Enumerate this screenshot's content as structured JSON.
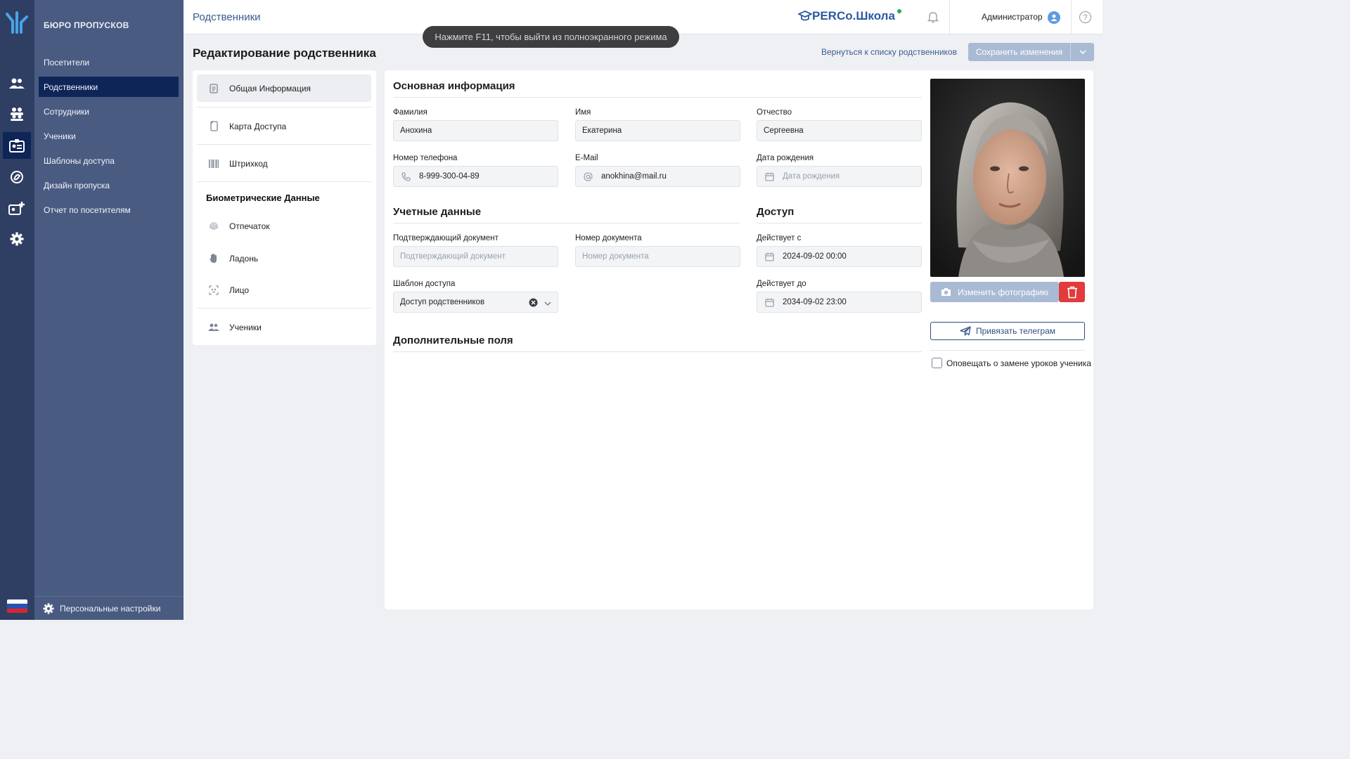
{
  "colors": {
    "rail": "#2f3f63",
    "menu": "#4a5b82",
    "active": "#0e2558",
    "accent": "#2c5aa0",
    "danger": "#e23b3b"
  },
  "menu": {
    "brand": "БЮРО ПРОПУСКОВ",
    "items": [
      {
        "label": "Посетители"
      },
      {
        "label": "Родственники"
      },
      {
        "label": "Сотрудники"
      },
      {
        "label": "Ученики"
      },
      {
        "label": "Шаблоны доступа"
      },
      {
        "label": "Дизайн пропуска"
      },
      {
        "label": "Отчет по посетителям"
      }
    ],
    "footer": "Персональные настройки"
  },
  "header": {
    "crumb": "Родственники",
    "product": "PERCo.Школа",
    "user": "Администратор",
    "help": "?"
  },
  "toast": "Нажмите F11, чтобы выйти из полноэкранного режима",
  "page": {
    "title": "Редактирование родственника",
    "back": "Вернуться к списку родственников",
    "save": "Сохранить изменения"
  },
  "tabs": {
    "general": "Общая Информация",
    "card": "Карта Доступа",
    "barcode": "Штрихкод",
    "bio_header": "Биометрические Данные",
    "fingerprint": "Отпечаток",
    "palm": "Ладонь",
    "face": "Лицо",
    "students": "Ученики"
  },
  "form": {
    "basic_title": "Основная информация",
    "lastname": {
      "label": "Фамилия",
      "value": "Анохина"
    },
    "firstname": {
      "label": "Имя",
      "value": "Екатерина"
    },
    "middlename": {
      "label": "Отчество",
      "value": "Сергеевна"
    },
    "phone": {
      "label": "Номер телефона",
      "value": "8-999-300-04-89"
    },
    "email": {
      "label": "E-Mail",
      "value": "anokhina@mail.ru"
    },
    "birth": {
      "label": "Дата рождения",
      "placeholder": "Дата рождения"
    },
    "account_title": "Учетные данные",
    "doc": {
      "label": "Подтверждающий документ",
      "placeholder": "Подтверждающий документ"
    },
    "docnum": {
      "label": "Номер документа",
      "placeholder": "Номер документа"
    },
    "template": {
      "label": "Шаблон доступа",
      "value": "Доступ родственников"
    },
    "access_title": "Доступ",
    "from": {
      "label": "Действует с",
      "value": "2024-09-02 00:00"
    },
    "to": {
      "label": "Действует до",
      "value": "2034-09-02 23:00"
    },
    "extra_title": "Дополнительные поля"
  },
  "photo": {
    "change": "Изменить фотографию",
    "telegram": "Привязать телеграм",
    "notify": "Оповещать о замене уроков ученика",
    "notify_checked": false
  }
}
